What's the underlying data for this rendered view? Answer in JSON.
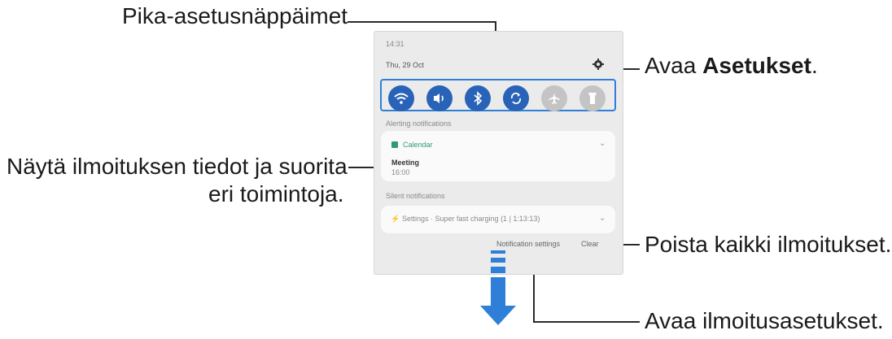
{
  "annotations": {
    "quick_settings": "Pika-asetusnäppäimet",
    "open_settings_prefix": "Avaa ",
    "open_settings_bold": "Asetukset",
    "open_settings_suffix": ".",
    "notification_details_line1": "Näytä ilmoituksen tiedot ja suorita",
    "notification_details_line2": "eri toimintoja.",
    "clear_all": "Poista kaikki ilmoitukset.",
    "open_notification_settings": "Avaa ilmoitusasetukset."
  },
  "phone": {
    "time": "14:31",
    "date": "Thu, 29 Oct",
    "quick_settings": [
      {
        "icon": "wifi-icon",
        "state": "on"
      },
      {
        "icon": "sound-icon",
        "state": "on"
      },
      {
        "icon": "bluetooth-icon",
        "state": "on"
      },
      {
        "icon": "auto-rotate-icon",
        "state": "on"
      },
      {
        "icon": "airplane-icon",
        "state": "off"
      },
      {
        "icon": "flashlight-icon",
        "state": "off"
      }
    ],
    "alerting_header": "Alerting notifications",
    "calendar_app": "Calendar",
    "event_title": "Meeting",
    "event_time": "16:00",
    "silent_header": "Silent notifications",
    "silent_text": "Settings · Super fast charging (1 | 1:13:13)",
    "notification_settings_button": "Notification settings",
    "clear_button": "Clear"
  },
  "colors": {
    "accent": "#2963b8",
    "highlight_border": "#2f7fd9",
    "calendar": "#2d9b78",
    "inactive": "#c4c4c4"
  }
}
